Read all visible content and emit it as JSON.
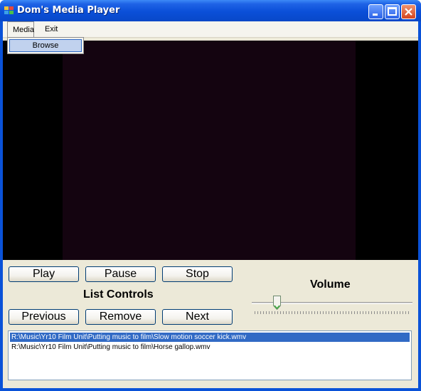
{
  "window": {
    "title": "Dom's Media Player"
  },
  "menu": {
    "items": [
      "Media",
      "Exit"
    ],
    "dropdown": [
      "Browse"
    ]
  },
  "controls": {
    "play": "Play",
    "pause": "Pause",
    "stop": "Stop",
    "list_label": "List Controls",
    "previous": "Previous",
    "remove": "Remove",
    "next": "Next"
  },
  "volume": {
    "label": "Volume",
    "level": 0.13
  },
  "playlist": {
    "items": [
      "R:\\Music\\Yr10 Film Unit\\Putting music to film\\Slow motion soccer kick.wmv",
      "R:\\Music\\Yr10 Film Unit\\Putting music to film\\Horse gallop.wmv"
    ],
    "selected_index": 0
  },
  "colors": {
    "titlebar": "#0a4fd8",
    "selection": "#316ac5",
    "video_bg": "#000000"
  }
}
